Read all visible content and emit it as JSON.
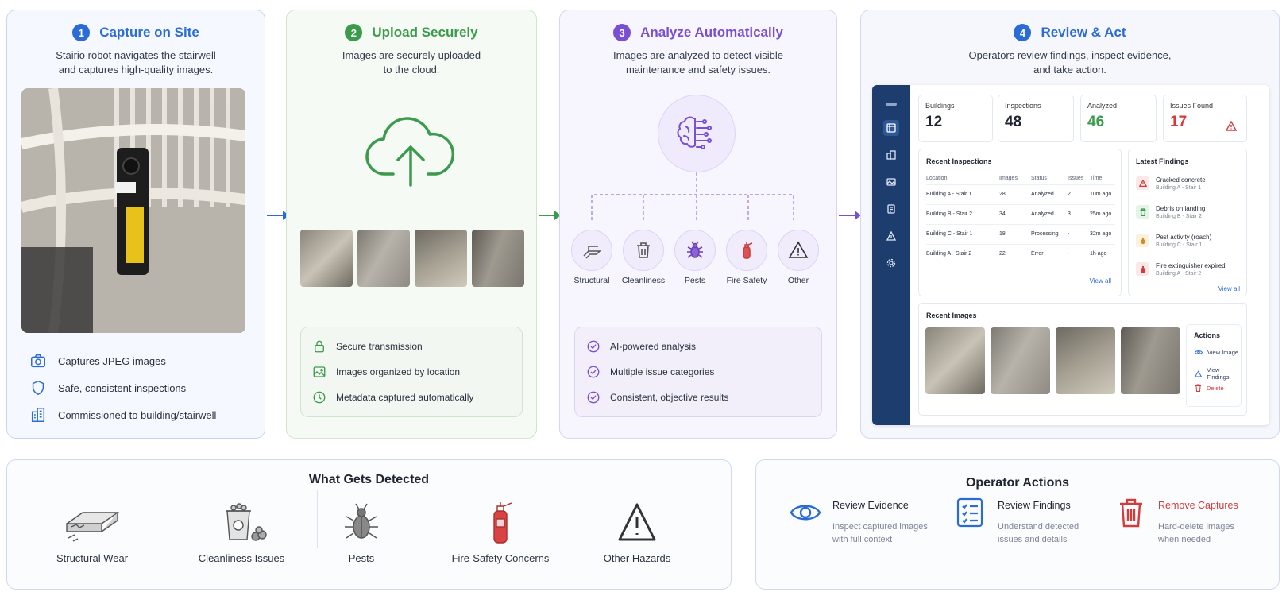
{
  "steps": [
    {
      "number": "1",
      "title": "Capture on Site",
      "description_line1": "Stairio robot navigates the stairwell",
      "description_line2": "and captures high-quality images.",
      "color": "#2a6bd6"
    },
    {
      "number": "2",
      "title": "Upload Securely",
      "description_line1": "Images are securely uploaded",
      "description_line2": "to the cloud.",
      "color": "#3c9a4c"
    },
    {
      "number": "3",
      "title": "Analyze Automatically",
      "description_line1": "Images are analyzed to detect visible",
      "description_line2": "maintenance and safety issues.",
      "color": "#7a4fd1"
    },
    {
      "number": "4",
      "title": "Review & Act",
      "description_line1": "Operators review findings, inspect evidence,",
      "description_line2": "and take action.",
      "color": "#2a6bd6"
    }
  ],
  "capture_features": [
    {
      "icon": "camera-icon",
      "label": "Captures JPEG images"
    },
    {
      "icon": "shield-icon",
      "label": "Safe, consistent inspections"
    },
    {
      "icon": "building-icon",
      "label": "Commissioned to building/stairwell"
    }
  ],
  "upload_features": [
    {
      "icon": "lock-icon",
      "label": "Secure transmission"
    },
    {
      "icon": "image-icon",
      "label": "Images organized by location"
    },
    {
      "icon": "clock-icon",
      "label": "Metadata captured automatically"
    }
  ],
  "analysis_categories": [
    {
      "icon": "structural-icon",
      "label": "Structural"
    },
    {
      "icon": "trash-icon",
      "label": "Cleanliness"
    },
    {
      "icon": "bug-icon",
      "label": "Pests"
    },
    {
      "icon": "fire-extinguisher-icon",
      "label": "Fire Safety"
    },
    {
      "icon": "warning-icon",
      "label": "Other"
    }
  ],
  "analysis_features": [
    {
      "icon": "check-circle-icon",
      "label": "AI-powered analysis"
    },
    {
      "icon": "check-circle-icon",
      "label": "Multiple issue categories"
    },
    {
      "icon": "check-circle-icon",
      "label": "Consistent, objective results"
    }
  ],
  "dashboard": {
    "stats": [
      {
        "label": "Buildings",
        "value": "12",
        "color": "#1f2430"
      },
      {
        "label": "Inspections",
        "value": "48",
        "color": "#1f2430"
      },
      {
        "label": "Analyzed",
        "value": "46",
        "color": "#3c9a4c"
      },
      {
        "label": "Issues Found",
        "value": "17",
        "color": "#d43b3b"
      }
    ],
    "recent_inspections": {
      "title": "Recent Inspections",
      "columns": [
        "Location",
        "Images",
        "Status",
        "Issues",
        "Time"
      ],
      "rows": [
        {
          "location": "Building A - Stair 1",
          "images": "28",
          "status": "Analyzed",
          "issues": "2",
          "time": "10m ago"
        },
        {
          "location": "Building B - Stair 2",
          "images": "34",
          "status": "Analyzed",
          "issues": "3",
          "time": "25m ago"
        },
        {
          "location": "Building C - Stair 1",
          "images": "18",
          "status": "Processing",
          "issues": "-",
          "time": "32m ago"
        },
        {
          "location": "Building A - Stair 2",
          "images": "22",
          "status": "Error",
          "issues": "-",
          "time": "1h ago"
        }
      ],
      "view_all": "View all"
    },
    "latest_findings": {
      "title": "Latest Findings",
      "items": [
        {
          "icon": "warning-icon",
          "title": "Cracked concrete",
          "location": "Building A - Stair 1",
          "color": "#d43b3b",
          "bg": "#fde8e8"
        },
        {
          "icon": "trash-icon",
          "title": "Debris on landing",
          "location": "Building B - Stair 2",
          "color": "#3c9a4c",
          "bg": "#e6f4e7"
        },
        {
          "icon": "bug-icon",
          "title": "Pest activity (roach)",
          "location": "Building C - Stair 1",
          "color": "#d98a1f",
          "bg": "#fdf1e0"
        },
        {
          "icon": "fire-extinguisher-icon",
          "title": "Fire extinguisher expired",
          "location": "Building A - Stair 2",
          "color": "#d43b3b",
          "bg": "#fde8e8"
        }
      ],
      "view_all": "View all"
    },
    "recent_images": {
      "title": "Recent Images"
    },
    "actions": {
      "title": "Actions",
      "items": [
        {
          "icon": "eye-icon",
          "label": "View Image"
        },
        {
          "icon": "findings-icon",
          "label": "View Findings"
        },
        {
          "icon": "trash-icon",
          "label": "Delete"
        }
      ]
    }
  },
  "detected": {
    "title": "What Gets Detected",
    "items": [
      {
        "icon": "structural-wear-icon",
        "label": "Structural Wear"
      },
      {
        "icon": "cleanliness-icon",
        "label": "Cleanliness Issues"
      },
      {
        "icon": "bug-icon",
        "label": "Pests"
      },
      {
        "icon": "fire-extinguisher-icon",
        "label": "Fire-Safety Concerns"
      },
      {
        "icon": "warning-icon",
        "label": "Other Hazards"
      }
    ]
  },
  "operator_actions": {
    "title": "Operator Actions",
    "items": [
      {
        "icon": "eye-icon",
        "title": "Review Evidence",
        "desc_line1": "Inspect captured images",
        "desc_line2": "with full context",
        "color": "#1f2430"
      },
      {
        "icon": "checklist-icon",
        "title": "Review Findings",
        "desc_line1": "Understand detected",
        "desc_line2": "issues and details",
        "color": "#1f2430"
      },
      {
        "icon": "trash-icon",
        "title": "Remove Captures",
        "desc_line1": "Hard-delete images",
        "desc_line2": "when needed",
        "color": "#d43b3b"
      }
    ]
  }
}
